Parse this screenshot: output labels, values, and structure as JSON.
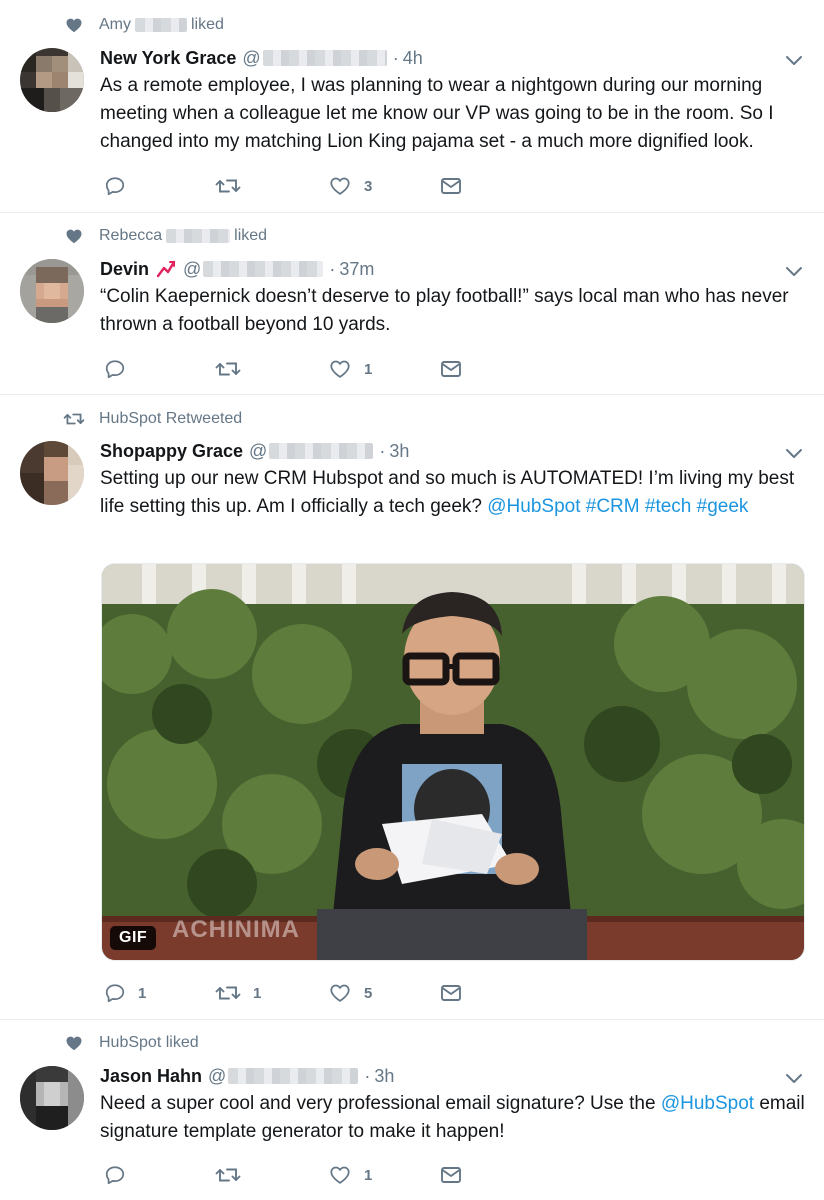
{
  "colors": {
    "link": "#1b95e0",
    "secondary": "#657786",
    "text": "#14171a",
    "divider": "#e6ecf0"
  },
  "tweets": [
    {
      "context": {
        "icon": "heart-icon",
        "user": "Amy",
        "suffix": "liked"
      },
      "author": {
        "name": "New York Grace",
        "handle": "@",
        "time": "4h"
      },
      "text": "As a remote employee, I was planning to wear a nightgown during our morning meeting when a colleague let me know our VP was going to be in the room. So I changed into my matching Lion King pajama set - a much more dignified look.",
      "counts": {
        "reply": "",
        "retweet": "",
        "like": "3"
      }
    },
    {
      "context": {
        "icon": "heart-icon",
        "user": "Rebecca",
        "suffix": "liked"
      },
      "author": {
        "name": "Devin",
        "badge_icon": "chart-trending-up-icon",
        "handle": "@",
        "time": "37m"
      },
      "text": "“Colin Kaepernick doesn’t deserve to play football!” says local man who has never thrown a football beyond 10 yards.",
      "counts": {
        "reply": "",
        "retweet": "",
        "like": "1"
      }
    },
    {
      "context": {
        "icon": "retweet-icon",
        "label": "HubSpot Retweeted"
      },
      "author": {
        "name": "Shopappy Grace",
        "handle": "@",
        "time": "3h"
      },
      "text_parts": {
        "plain": "Setting up our new CRM Hubspot and so much is AUTOMATED! I’m living my best life setting this up. Am I officially a tech geek? ",
        "mention": "@HubSpot",
        "hashtags": [
          "#CRM",
          "#tech",
          "#geek"
        ]
      },
      "media": {
        "badge": "GIF",
        "watermark": "ACHINIMA"
      },
      "counts": {
        "reply": "1",
        "retweet": "1",
        "like": "5"
      }
    },
    {
      "context": {
        "icon": "heart-icon",
        "label": "HubSpot liked"
      },
      "author": {
        "name": "Jason Hahn",
        "handle": "@",
        "time": "3h"
      },
      "text_parts": {
        "before": "Need a super cool and very professional email signature?  Use the ",
        "mention": "@HubSpot",
        "after": " email signature template generator to make it happen!"
      },
      "counts": {
        "reply": "",
        "retweet": "",
        "like": "1"
      }
    }
  ]
}
